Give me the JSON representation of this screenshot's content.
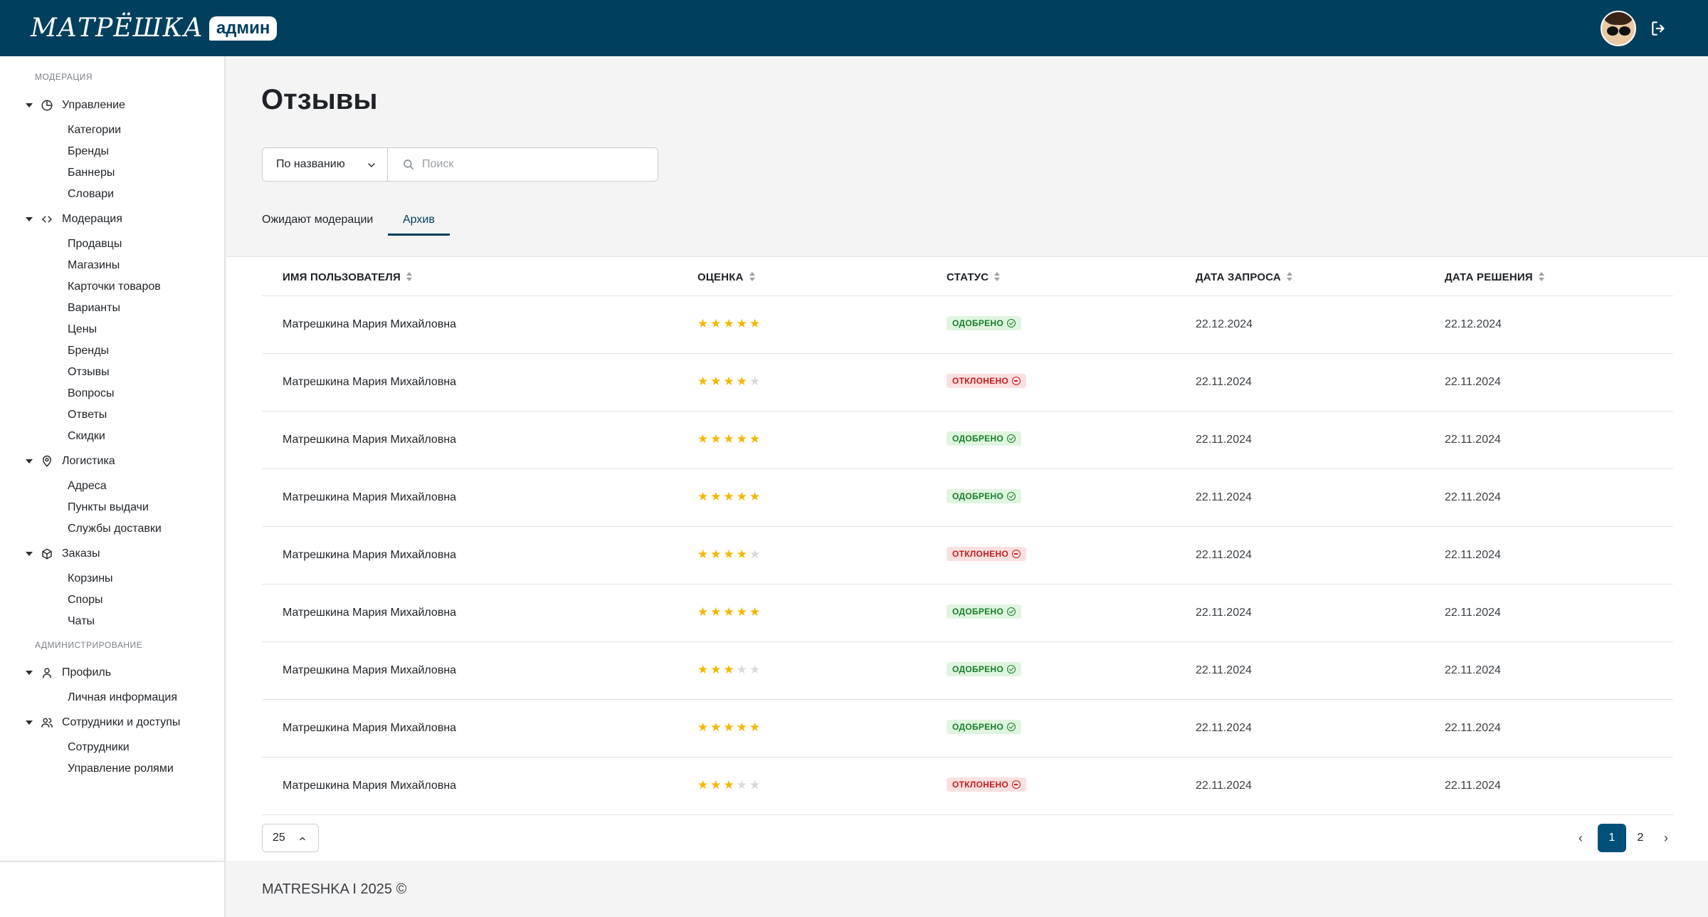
{
  "header": {
    "logo_word": "МАТРЁШКА",
    "logo_badge": "админ"
  },
  "sidebar": {
    "sections": [
      {
        "title": "МОДЕРАЦИЯ",
        "groups": [
          {
            "label": "Управление",
            "icon": "pie-chart-icon",
            "items": [
              "Категории",
              "Бренды",
              "Баннеры",
              "Словари"
            ]
          },
          {
            "label": "Модерация",
            "icon": "code-icon",
            "items": [
              "Продавцы",
              "Магазины",
              "Карточки товаров",
              "Варианты",
              "Цены",
              "Бренды",
              "Отзывы",
              "Вопросы",
              "Ответы",
              "Скидки"
            ]
          },
          {
            "label": "Логистика",
            "icon": "map-pin-icon",
            "items": [
              "Адреса",
              "Пункты выдачи",
              "Службы доставки"
            ]
          },
          {
            "label": "Заказы",
            "icon": "box-icon",
            "items": [
              "Корзины",
              "Споры",
              "Чаты"
            ]
          }
        ]
      },
      {
        "title": "АДМИНИСТРИРОВАНИЕ",
        "groups": [
          {
            "label": "Профиль",
            "icon": "user-icon",
            "items": [
              "Личная информация"
            ]
          },
          {
            "label": "Сотрудники и доступы",
            "icon": "users-icon",
            "items": [
              "Сотрудники",
              "Управление ролями"
            ]
          }
        ]
      }
    ]
  },
  "page": {
    "title": "Отзывы",
    "filter_select": "По названию",
    "search_placeholder": "Поиск",
    "tabs": [
      "Ожидают модерации",
      "Архив"
    ],
    "active_tab": "Архив"
  },
  "table": {
    "columns": [
      "ИМЯ ПОЛЬЗОВАТЕЛЯ",
      "ОЦЕНКА",
      "СТАТУС",
      "ДАТА ЗАПРОСА",
      "ДАТА РЕШЕНИЯ"
    ],
    "rows": [
      {
        "name": "Матрешкина Мария Михайловна",
        "rating": 5,
        "status": "ОДОБРЕНО",
        "status_type": "ok",
        "request_date": "22.12.2024",
        "decision_date": "22.12.2024"
      },
      {
        "name": "Матрешкина Мария Михайловна",
        "rating": 4,
        "status": "ОТКЛОНЕНО",
        "status_type": "no",
        "request_date": "22.11.2024",
        "decision_date": "22.11.2024"
      },
      {
        "name": "Матрешкина Мария Михайловна",
        "rating": 5,
        "status": "ОДОБРЕНО",
        "status_type": "ok",
        "request_date": "22.11.2024",
        "decision_date": "22.11.2024"
      },
      {
        "name": "Матрешкина Мария Михайловна",
        "rating": 5,
        "status": "ОДОБРЕНО",
        "status_type": "ok",
        "request_date": "22.11.2024",
        "decision_date": "22.11.2024"
      },
      {
        "name": "Матрешкина Мария Михайловна",
        "rating": 4,
        "status": "ОТКЛОНЕНО",
        "status_type": "no",
        "request_date": "22.11.2024",
        "decision_date": "22.11.2024"
      },
      {
        "name": "Матрешкина Мария Михайловна",
        "rating": 5,
        "status": "ОДОБРЕНО",
        "status_type": "ok",
        "request_date": "22.11.2024",
        "decision_date": "22.11.2024"
      },
      {
        "name": "Матрешкина Мария Михайловна",
        "rating": 3,
        "status": "ОДОБРЕНО",
        "status_type": "ok",
        "request_date": "22.11.2024",
        "decision_date": "22.11.2024"
      },
      {
        "name": "Матрешкина Мария Михайловна",
        "rating": 5,
        "status": "ОДОБРЕНО",
        "status_type": "ok",
        "request_date": "22.11.2024",
        "decision_date": "22.11.2024"
      },
      {
        "name": "Матрешкина Мария Михайловна",
        "rating": 3,
        "status": "ОТКЛОНЕНО",
        "status_type": "no",
        "request_date": "22.11.2024",
        "decision_date": "22.11.2024"
      }
    ]
  },
  "pagination": {
    "per_page": "25",
    "pages": [
      "1",
      "2"
    ],
    "current": "1"
  },
  "footer": {
    "text": "MATRESHKA I 2025 ©"
  },
  "colors": {
    "brand": "#003f5e",
    "star": "#f7b500",
    "approved_bg": "#dff5df",
    "rejected_bg": "#fbe0e0"
  }
}
